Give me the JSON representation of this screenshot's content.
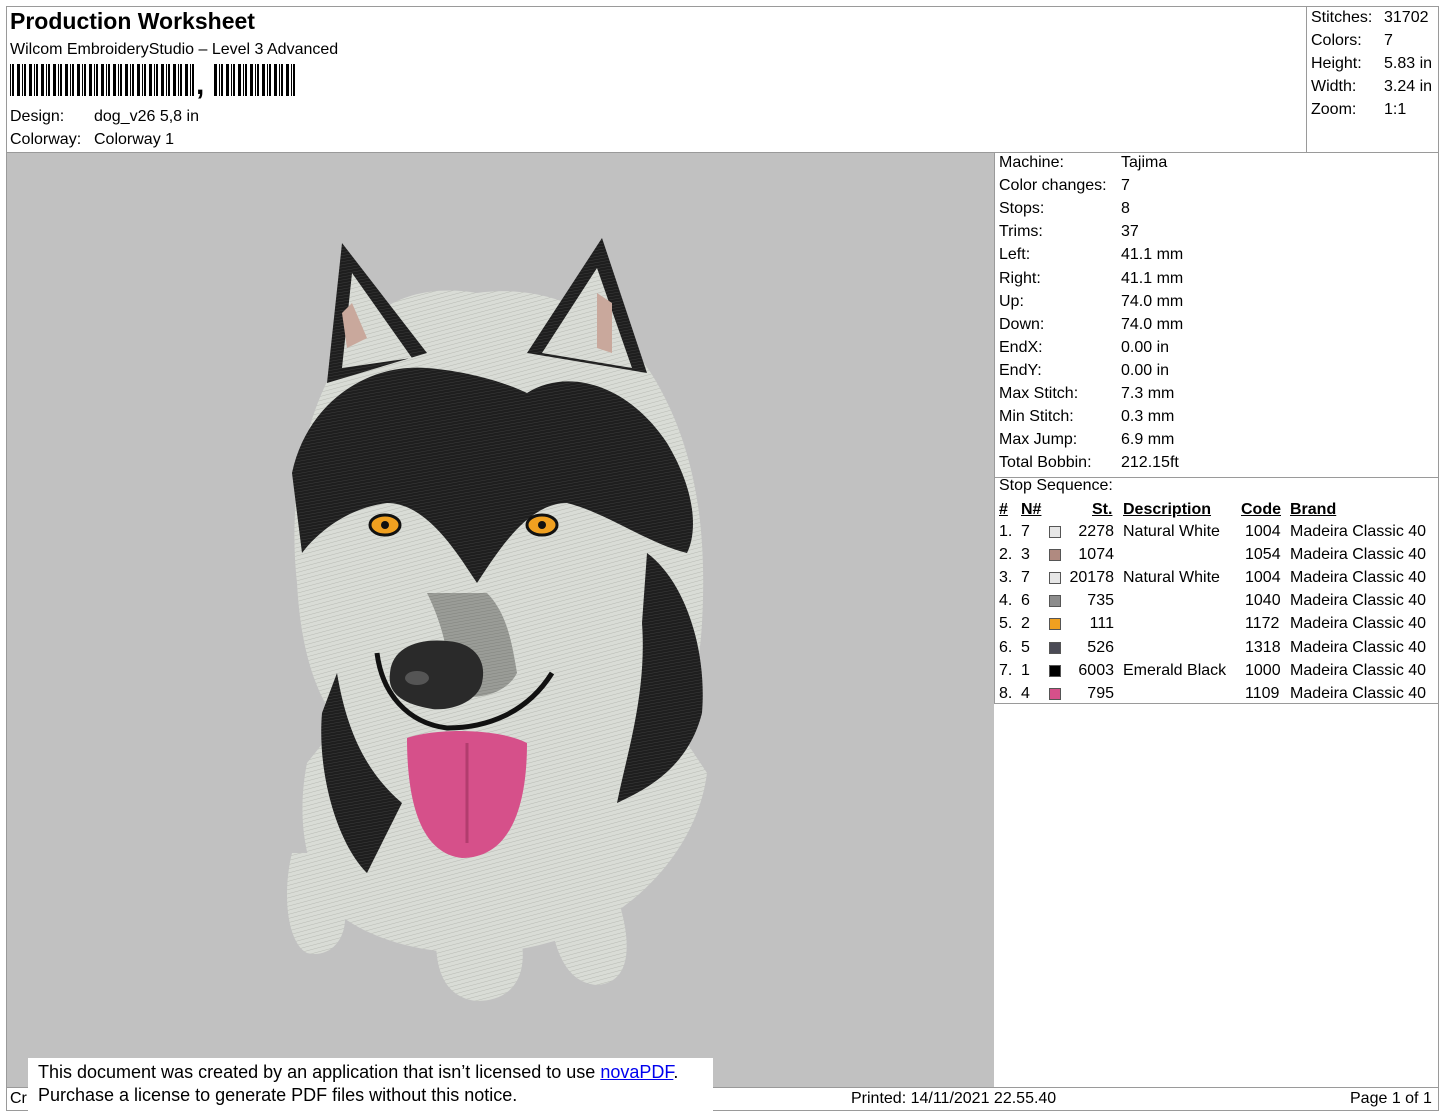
{
  "header": {
    "title": "Production Worksheet",
    "software": "Wilcom EmbroideryStudio – Level 3 Advanced",
    "barcode_comma": ",",
    "design_label": "Design:",
    "design_value": "dog_v26 5,8 in",
    "colorway_label": "Colorway:",
    "colorway_value": "Colorway 1"
  },
  "stats": [
    {
      "label": "Stitches:",
      "value": "31702"
    },
    {
      "label": "Colors:",
      "value": "7"
    },
    {
      "label": "Height:",
      "value": "5.83 in"
    },
    {
      "label": "Width:",
      "value": "3.24 in"
    },
    {
      "label": "Zoom:",
      "value": "1:1"
    }
  ],
  "machine_info": [
    {
      "label": "Machine:",
      "value": "Tajima"
    },
    {
      "label": "Color changes:",
      "value": "7"
    },
    {
      "label": "Stops:",
      "value": "8"
    },
    {
      "label": "Trims:",
      "value": "37"
    },
    {
      "label": "Left:",
      "value": "41.1 mm"
    },
    {
      "label": "Right:",
      "value": "41.1 mm"
    },
    {
      "label": "Up:",
      "value": "74.0 mm"
    },
    {
      "label": "Down:",
      "value": "74.0 mm"
    },
    {
      "label": "EndX:",
      "value": "0.00 in"
    },
    {
      "label": "EndY:",
      "value": "0.00 in"
    },
    {
      "label": "Max Stitch:",
      "value": "7.3 mm"
    },
    {
      "label": "Min Stitch:",
      "value": "0.3 mm"
    },
    {
      "label": "Max Jump:",
      "value": "6.9 mm"
    },
    {
      "label": "Total Bobbin:",
      "value": "212.15ft"
    }
  ],
  "stop_sequence": {
    "label": "Stop Sequence:",
    "headers": {
      "index": "#",
      "needle": "N#",
      "stitches": "St.",
      "description": "Description",
      "code": "Code",
      "brand": "Brand"
    },
    "rows": [
      {
        "index": "1.",
        "needle": "7",
        "color": "#e6e6e6",
        "stitches": "2278",
        "description": "Natural White",
        "code": "1004",
        "brand": "Madeira Classic 40"
      },
      {
        "index": "2.",
        "needle": "3",
        "color": "#b08a80",
        "stitches": "1074",
        "description": "",
        "code": "1054",
        "brand": "Madeira Classic 40"
      },
      {
        "index": "3.",
        "needle": "7",
        "color": "#e6e6e6",
        "stitches": "20178",
        "description": "Natural White",
        "code": "1004",
        "brand": "Madeira Classic 40"
      },
      {
        "index": "4.",
        "needle": "6",
        "color": "#8c8c8c",
        "stitches": "735",
        "description": "",
        "code": "1040",
        "brand": "Madeira Classic 40"
      },
      {
        "index": "5.",
        "needle": "2",
        "color": "#f0a020",
        "stitches": "111",
        "description": "",
        "code": "1172",
        "brand": "Madeira Classic 40"
      },
      {
        "index": "6.",
        "needle": "5",
        "color": "#4a4a55",
        "stitches": "526",
        "description": "",
        "code": "1318",
        "brand": "Madeira Classic 40"
      },
      {
        "index": "7.",
        "needle": "1",
        "color": "#000000",
        "stitches": "6003",
        "description": "Emerald Black",
        "code": "1000",
        "brand": "Madeira Classic 40"
      },
      {
        "index": "8.",
        "needle": "4",
        "color": "#d6508a",
        "stitches": "795",
        "description": "",
        "code": "1109",
        "brand": "Madeira Classic 40"
      }
    ]
  },
  "footer": {
    "left_fragment": "Cr",
    "printed": "Printed: 14/11/2021 22.55.40",
    "page": "Page 1 of 1"
  },
  "notice": {
    "line1_prefix": "This document was created by an application that isn’t licensed to use ",
    "link": "novaPDF",
    "line1_suffix": ".",
    "line2": "Purchase a license to generate PDF files without this notice."
  },
  "colors": {
    "canvas": "#c1c1c1",
    "border": "#9a9a9a",
    "link": "#0000ee"
  }
}
